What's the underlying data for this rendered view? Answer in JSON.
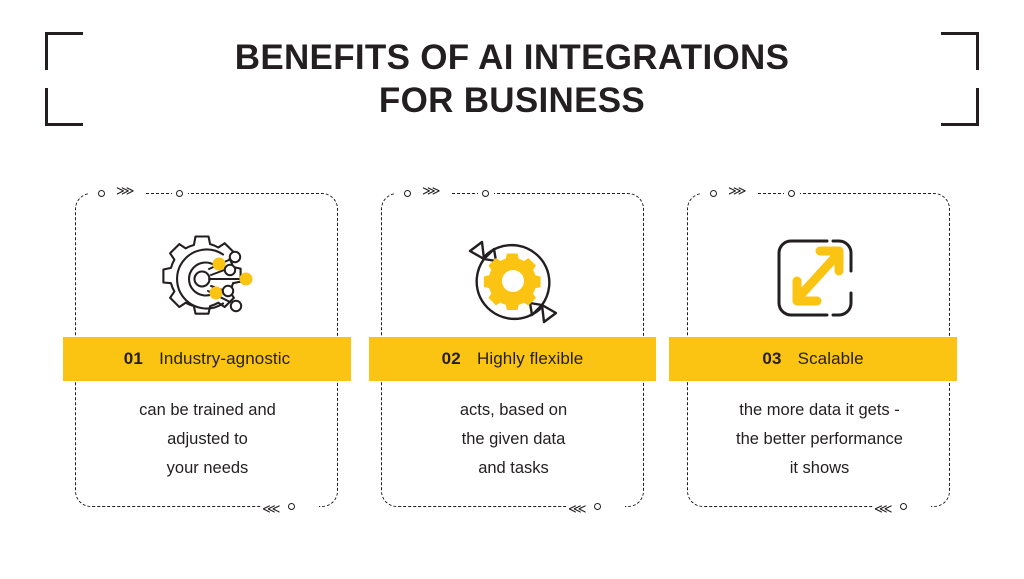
{
  "header": {
    "title_line1": "BENEFITS OF AI INTEGRATIONS",
    "title_line2": "FOR BUSINESS"
  },
  "colors": {
    "accent_yellow": "#fbc312",
    "ink": "#231f20",
    "background": "#ffffff"
  },
  "decor": {
    "chevron_right": "⋙",
    "chevron_left": "⋘"
  },
  "cards": [
    {
      "number": "01",
      "label": "Industry-agnostic",
      "icon": "gear-network-icon",
      "body_lines": [
        "can be trained and",
        "adjusted to",
        "your needs"
      ]
    },
    {
      "number": "02",
      "label": "Highly flexible",
      "icon": "cycle-gear-icon",
      "body_lines": [
        "acts, based on",
        "the given data",
        "and tasks"
      ]
    },
    {
      "number": "03",
      "label": "Scalable",
      "icon": "scale-expand-icon",
      "body_lines": [
        "the more data it gets -",
        "the better performance",
        "it shows"
      ]
    }
  ]
}
